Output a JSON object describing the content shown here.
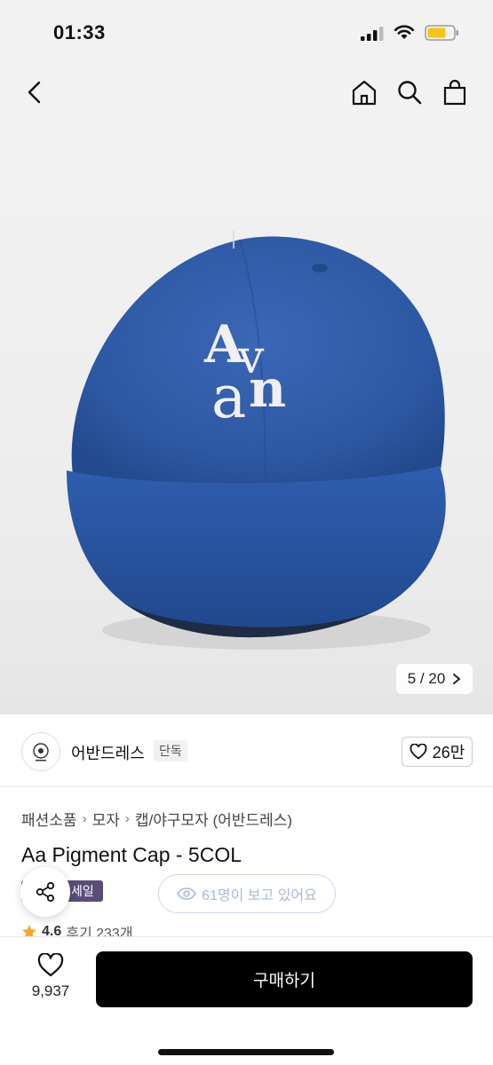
{
  "status_bar": {
    "time": "01:33",
    "icons": [
      "cellular-signal-icon",
      "wifi-icon",
      "battery-icon"
    ],
    "battery_color": "#f5c518"
  },
  "nav": {
    "icons": [
      "back-arrow-icon",
      "home-icon",
      "search-icon",
      "shopping-bag-icon"
    ]
  },
  "hero": {
    "image_logo_text": "Avan",
    "cap_color": "#2f5aa6",
    "counter_current": "5",
    "counter_separator": "/",
    "counter_total": "20",
    "counter_icon": "chevron-right-icon"
  },
  "store": {
    "name": "어반드레스",
    "badge": "단독",
    "likes": "26만",
    "like_icon": "heart-outline-icon",
    "logo_icon": "store-logo-icon"
  },
  "breadcrumb": [
    "패션소품",
    "모자",
    "캡/야구모자 (어반드레스)"
  ],
  "product": {
    "title": "Aa Pigment Cap - 5COL",
    "sale_badge": "세일",
    "sale_badge_color": "#5b4d7a",
    "viewers_text": "61명이 보고 있어요",
    "viewers_icon": "eye-icon",
    "share_icon": "share-icon",
    "rating": "4.6",
    "reviews_label": "후기 233개",
    "star_color": "#f5a623"
  },
  "bottom": {
    "wish_count": "9,937",
    "wish_icon": "heart-outline-icon",
    "buy_label": "구매하기",
    "buy_color": "#000000"
  }
}
